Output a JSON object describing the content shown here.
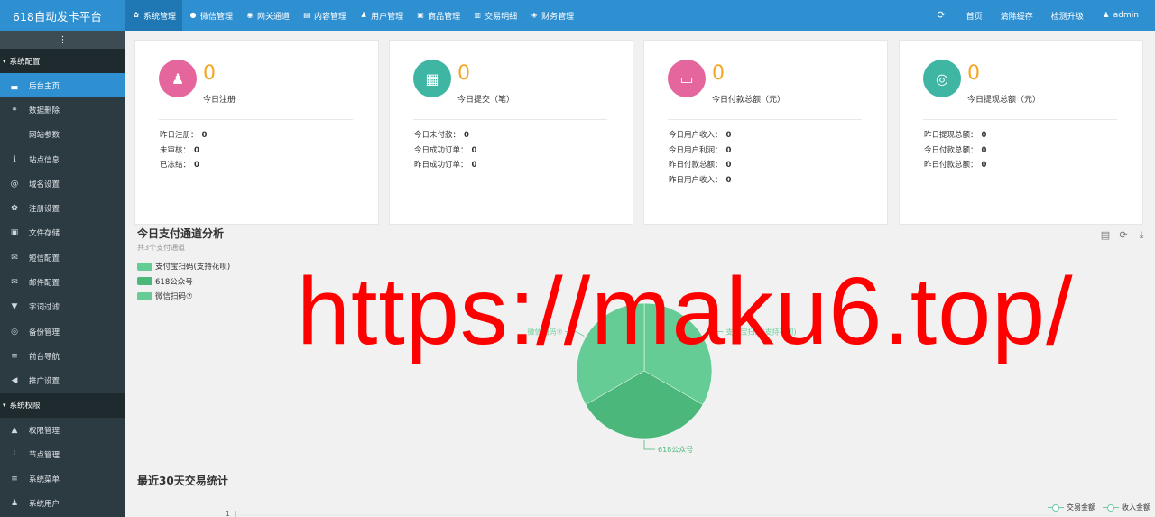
{
  "app": {
    "brand": "618自动发卡平台"
  },
  "topnav": [
    {
      "label": "系统管理",
      "icon": "gear-icon",
      "glyph": "✿"
    },
    {
      "label": "微信管理",
      "icon": "wechat-icon",
      "glyph": "●"
    },
    {
      "label": "网关通道",
      "icon": "gateway-icon",
      "glyph": "◉"
    },
    {
      "label": "内容管理",
      "icon": "document-icon",
      "glyph": "▤"
    },
    {
      "label": "用户管理",
      "icon": "users-icon",
      "glyph": "♟"
    },
    {
      "label": "商品管理",
      "icon": "shop-icon",
      "glyph": "▣"
    },
    {
      "label": "交易明细",
      "icon": "bar-chart-icon",
      "glyph": "▥"
    },
    {
      "label": "财务管理",
      "icon": "finance-icon",
      "glyph": "◈"
    }
  ],
  "topright": {
    "refresh_glyph": "⟳",
    "home": "首页",
    "clear_cache": "清除缓存",
    "upgrade": "检测升级",
    "user": "admin",
    "user_glyph": "♟"
  },
  "sidebar": {
    "toggle_glyph": "⋮",
    "sections": [
      {
        "title": "系统配置",
        "items": [
          {
            "label": "后台主页",
            "glyph": "▃",
            "icon": "area-chart-icon",
            "active": true
          },
          {
            "label": "数据删除",
            "glyph": "⚭",
            "icon": "link-icon"
          },
          {
            "label": "网站参数",
            "glyph": "",
            "icon": "apple-icon"
          },
          {
            "label": "站点信息",
            "glyph": "ℹ",
            "icon": "info-icon"
          },
          {
            "label": "域名设置",
            "glyph": "@",
            "icon": "at-icon"
          },
          {
            "label": "注册设置",
            "glyph": "✿",
            "icon": "gear-icon"
          },
          {
            "label": "文件存储",
            "glyph": "▣",
            "icon": "save-icon"
          },
          {
            "label": "短信配置",
            "glyph": "✉",
            "icon": "envelope-icon"
          },
          {
            "label": "邮件配置",
            "glyph": "✉",
            "icon": "mail-icon"
          },
          {
            "label": "字词过滤",
            "glyph": "▼",
            "icon": "filter-icon"
          },
          {
            "label": "备份管理",
            "glyph": "◎",
            "icon": "database-icon"
          },
          {
            "label": "前台导航",
            "glyph": "≡",
            "icon": "menu-icon"
          },
          {
            "label": "推广设置",
            "glyph": "◀",
            "icon": "bullhorn-icon"
          }
        ]
      },
      {
        "title": "系统权限",
        "items": [
          {
            "label": "权限管理",
            "glyph": "▲",
            "icon": "lock-icon"
          },
          {
            "label": "节点管理",
            "glyph": "⋮",
            "icon": "node-icon"
          },
          {
            "label": "系统菜单",
            "glyph": "≡",
            "icon": "list-icon"
          },
          {
            "label": "系统用户",
            "glyph": "♟",
            "icon": "users-icon"
          }
        ]
      }
    ]
  },
  "cards": [
    {
      "value": "0",
      "label": "今日注册",
      "icon": "users-icon",
      "glyph": "♟",
      "color": "#e5669c",
      "rows": [
        {
          "k": "昨日注册：",
          "v": "0"
        },
        {
          "k": "未审核：",
          "v": "0"
        },
        {
          "k": "已冻结：",
          "v": "0"
        }
      ]
    },
    {
      "value": "0",
      "label": "今日提交（笔）",
      "icon": "calendar-icon",
      "glyph": "▦",
      "color": "#3fb5a3",
      "rows": [
        {
          "k": "今日未付款：",
          "v": "0"
        },
        {
          "k": "今日成功订单：",
          "v": "0"
        },
        {
          "k": "昨日成功订单：",
          "v": "0"
        }
      ]
    },
    {
      "value": "0",
      "label": "今日付款总额（元）",
      "icon": "credit-card-icon",
      "glyph": "▭",
      "color": "#e5669c",
      "rows": [
        {
          "k": "今日用户收入：",
          "v": "0"
        },
        {
          "k": "今日用户利润：",
          "v": "0"
        },
        {
          "k": "昨日付款总额：",
          "v": "0"
        },
        {
          "k": "昨日用户收入：",
          "v": "0"
        }
      ]
    },
    {
      "value": "0",
      "label": "今日提现总额（元）",
      "icon": "database-icon",
      "glyph": "◎",
      "color": "#3fb5a3",
      "rows": [
        {
          "k": "昨日提现总额：",
          "v": "0"
        },
        {
          "k": "今日付款总额：",
          "v": "0"
        },
        {
          "k": "昨日付款总额：",
          "v": "0"
        }
      ]
    }
  ],
  "pie_section": {
    "title": "今日支付通道分析",
    "subtitle": "共3个支付通道",
    "tools": [
      {
        "glyph": "▤",
        "icon": "data-view-icon"
      },
      {
        "glyph": "⟳",
        "icon": "refresh-icon"
      },
      {
        "glyph": "⤓",
        "icon": "download-icon"
      }
    ]
  },
  "line_section": {
    "title": "最近30天交易统计",
    "legend": [
      "交易金额",
      "收入金额"
    ],
    "y_tick": "1"
  },
  "watermark": "https://maku6.top/",
  "chart_data": {
    "type": "pie",
    "title": "今日支付通道分析",
    "subtitle": "共3个支付通道",
    "legend_position": "left",
    "slices": [
      {
        "name": "支付宝扫码(支持花呗)",
        "value": 1,
        "color": "#66cc95"
      },
      {
        "name": "618公众号",
        "value": 1,
        "color": "#4bb77a"
      },
      {
        "name": "微信扫码⑦",
        "value": 1,
        "color": "#66cc95"
      }
    ]
  }
}
